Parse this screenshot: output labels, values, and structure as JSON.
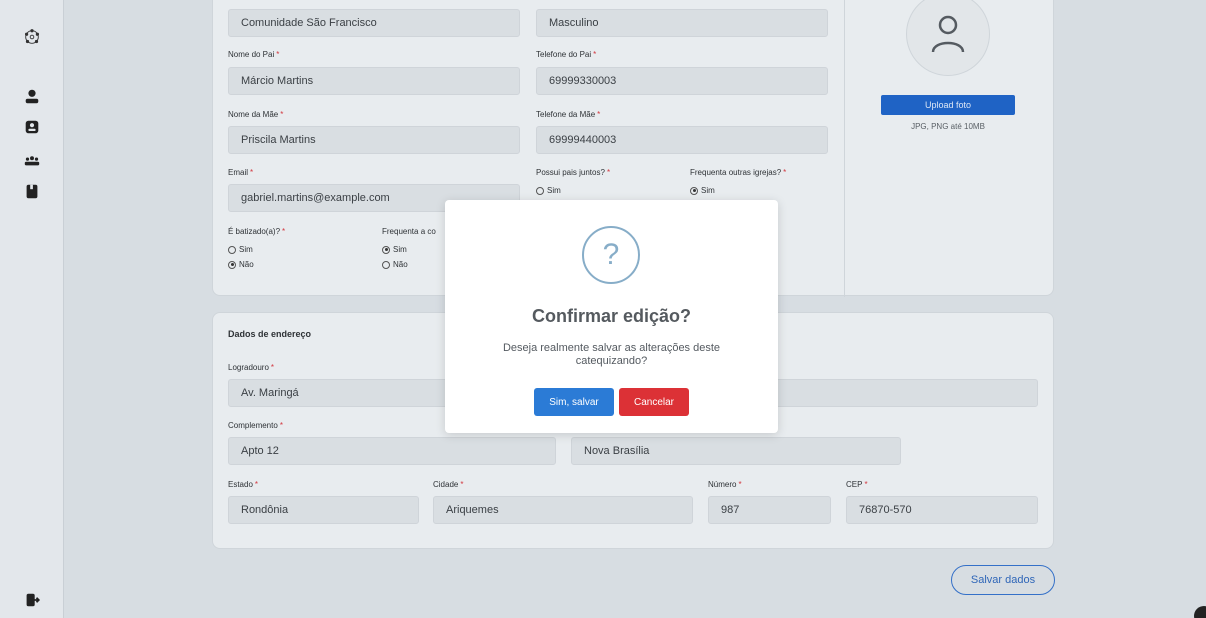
{
  "profile": {
    "community": "Comunidade São Francisco",
    "gender": "Masculino",
    "father_name_label": "Nome do Pai",
    "father_name": "Márcio Martins",
    "father_phone_label": "Telefone do Pai",
    "father_phone": "69999330003",
    "mother_name_label": "Nome da Mãe",
    "mother_name": "Priscila Martins",
    "mother_phone_label": "Telefone da Mãe",
    "mother_phone": "69999440003",
    "email_label": "Email",
    "email": "gabriel.martins@example.com",
    "parents_together_label": "Possui pais juntos?",
    "parents_together_sim": "Sim",
    "other_churches_label": "Frequenta outras igrejas?",
    "other_churches_sim": "Sim",
    "baptized_label": "É batizado(a)?",
    "baptized_sim": "Sim",
    "baptized_nao": "Não",
    "frequents_label": "Frequenta a co",
    "frequents_sim": "Sim",
    "frequents_nao": "Não",
    "required_mark": "*"
  },
  "photo": {
    "upload_label": "Upload foto",
    "hint": "JPG, PNG até 10MB"
  },
  "address": {
    "section_title": "Dados de endereço",
    "street_label": "Logradouro",
    "street": "Av. Maringá",
    "complement_label": "Complemento",
    "complement": "Apto 12",
    "neighborhood": "Nova Brasília",
    "state_label": "Estado",
    "state": "Rondônia",
    "city_label": "Cidade",
    "city": "Ariquemes",
    "number_label": "Número",
    "number": "987",
    "cep_label": "CEP",
    "cep": "76870-570"
  },
  "actions": {
    "save_label": "Salvar dados"
  },
  "modal": {
    "icon": "?",
    "title": "Confirmar edição?",
    "text": "Deseja realmente salvar as alterações deste catequizando?",
    "confirm_label": "Sim, salvar",
    "cancel_label": "Cancelar"
  },
  "colors": {
    "primary": "#2b7bd6",
    "danger": "#dc3136",
    "required": "#d2373f"
  }
}
